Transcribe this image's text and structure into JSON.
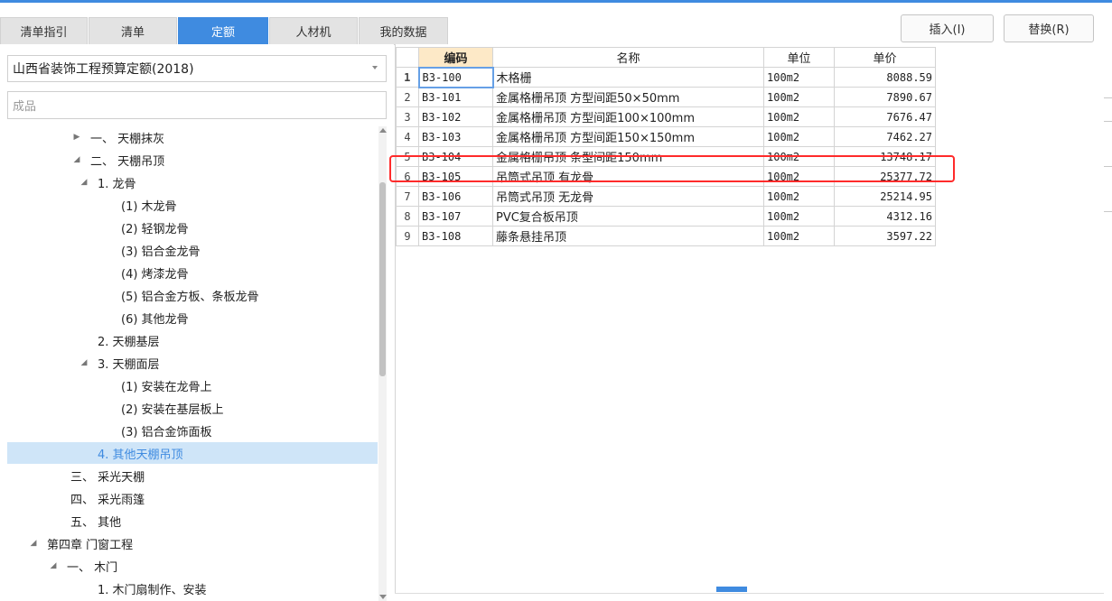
{
  "tabs": [
    {
      "label": "清单指引"
    },
    {
      "label": "清单"
    },
    {
      "label": "定额"
    },
    {
      "label": "人材机"
    },
    {
      "label": "我的数据"
    }
  ],
  "buttons": {
    "insert": "插入(I)",
    "replace": "替换(R)"
  },
  "left": {
    "library_select": "山西省装饰工程预算定额(2018)",
    "search_value": "成品",
    "tree": [
      {
        "label": "一、 天棚抹灰",
        "toggle": "▶",
        "level": 3
      },
      {
        "label": "二、 天棚吊顶",
        "toggle": "◢",
        "level": 3
      },
      {
        "label": "1. 龙骨",
        "toggle": "◢",
        "level": 4
      },
      {
        "label": "(1) 木龙骨",
        "toggle": "",
        "level": 5
      },
      {
        "label": "(2) 轻钢龙骨",
        "toggle": "",
        "level": 5
      },
      {
        "label": "(3) 铝合金龙骨",
        "toggle": "",
        "level": 5
      },
      {
        "label": "(4) 烤漆龙骨",
        "toggle": "",
        "level": 5
      },
      {
        "label": "(5) 铝合金方板、条板龙骨",
        "toggle": "",
        "level": 5
      },
      {
        "label": "(6) 其他龙骨",
        "toggle": "",
        "level": 5
      },
      {
        "label": "2. 天棚基层",
        "toggle": "",
        "level": 4
      },
      {
        "label": "3. 天棚面层",
        "toggle": "◢",
        "level": 4
      },
      {
        "label": "(1) 安装在龙骨上",
        "toggle": "",
        "level": 5
      },
      {
        "label": "(2) 安装在基层板上",
        "toggle": "",
        "level": 5
      },
      {
        "label": "(3) 铝合金饰面板",
        "toggle": "",
        "level": 5
      },
      {
        "label": "4. 其他天棚吊顶",
        "toggle": "",
        "level": 4,
        "selected": true
      },
      {
        "label": "三、 采光天棚",
        "toggle": "",
        "level": 3
      },
      {
        "label": "四、 采光雨篷",
        "toggle": "",
        "level": 3
      },
      {
        "label": "五、 其他",
        "toggle": "",
        "level": 3
      },
      {
        "label": "第四章 门窗工程",
        "toggle": "◢",
        "level": 1
      },
      {
        "label": "一、 木门",
        "toggle": "◢",
        "level": 2
      },
      {
        "label": "1. 木门扇制作、安装",
        "toggle": "",
        "level": 4
      }
    ]
  },
  "grid": {
    "headers": {
      "code": "编码",
      "name": "名称",
      "unit": "单位",
      "price": "单价"
    },
    "rows": [
      {
        "n": "1",
        "code": "B3-100",
        "name": "木格栅",
        "unit": "100m2",
        "price": "8088.59"
      },
      {
        "n": "2",
        "code": "B3-101",
        "name": "金属格栅吊顶 方型间距50×50mm",
        "unit": "100m2",
        "price": "7890.67"
      },
      {
        "n": "3",
        "code": "B3-102",
        "name": "金属格栅吊顶 方型间距100×100mm",
        "unit": "100m2",
        "price": "7676.47"
      },
      {
        "n": "4",
        "code": "B3-103",
        "name": "金属格栅吊顶 方型间距150×150mm",
        "unit": "100m2",
        "price": "7462.27"
      },
      {
        "n": "5",
        "code": "B3-104",
        "name": "金属格栅吊顶 条型间距150mm",
        "unit": "100m2",
        "price": "13748.17"
      },
      {
        "n": "6",
        "code": "B3-105",
        "name": "吊筒式吊顶 有龙骨",
        "unit": "100m2",
        "price": "25377.72"
      },
      {
        "n": "7",
        "code": "B3-106",
        "name": "吊筒式吊顶 无龙骨",
        "unit": "100m2",
        "price": "25214.95"
      },
      {
        "n": "8",
        "code": "B3-107",
        "name": "PVC复合板吊顶",
        "unit": "100m2",
        "price": "4312.16"
      },
      {
        "n": "9",
        "code": "B3-108",
        "name": "藤条悬挂吊顶",
        "unit": "100m2",
        "price": "3597.22"
      }
    ]
  },
  "colors": {
    "accent": "#3f8be0",
    "highlight": "#ff2b2b",
    "header_code_bg": "#fde9c7",
    "selected_row_bg": "#cfe5f8"
  }
}
